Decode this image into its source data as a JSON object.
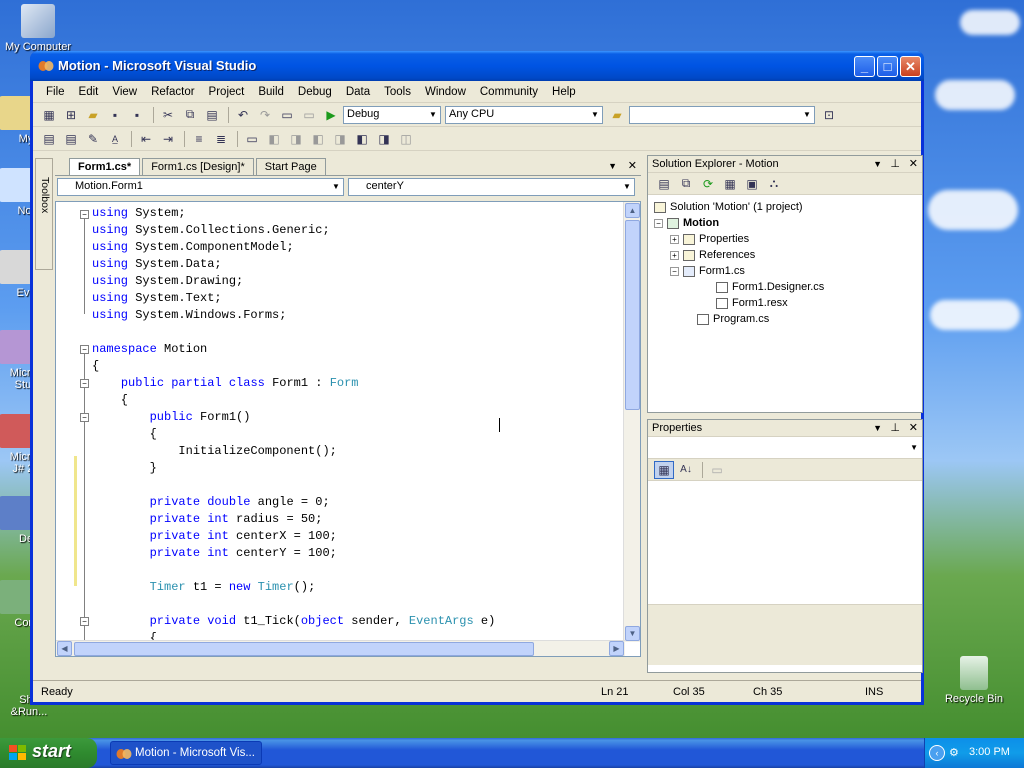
{
  "desktop": {
    "icons": {
      "my_computer": "My Computer",
      "recycle_bin": "Recycle Bin",
      "partial_my": "My",
      "partial_not": "Not",
      "partial_eve": "Eve",
      "partial_micro1": "Micros",
      "partial_stu": "Stud",
      "partial_micro2": "Micros",
      "partial_j": "J# 20",
      "partial_de": "De",
      "partial_cont": "Cont",
      "partial_sho": "Sho",
      "partial_run": "&Run..."
    }
  },
  "window": {
    "title": "Motion - Microsoft Visual Studio",
    "controls": {
      "minimize": "_",
      "maximize": "□",
      "close": "✕"
    }
  },
  "menu": [
    "File",
    "Edit",
    "View",
    "Refactor",
    "Project",
    "Build",
    "Debug",
    "Data",
    "Tools",
    "Window",
    "Community",
    "Help"
  ],
  "toolbar": {
    "config": "Debug",
    "platform": "Any CPU",
    "find_value": ""
  },
  "toolbox_label": "Toolbox",
  "editor": {
    "tabs": [
      "Form1.cs*",
      "Form1.cs [Design]*",
      "Start Page"
    ],
    "tab_controls": {
      "dropdown": "▼",
      "close": "✕"
    },
    "nav_left": "Motion.Form1",
    "nav_right": "centerY",
    "code_lines": [
      "using System;",
      "using System.Collections.Generic;",
      "using System.ComponentModel;",
      "using System.Data;",
      "using System.Drawing;",
      "using System.Text;",
      "using System.Windows.Forms;",
      "",
      "namespace Motion",
      "{",
      "    public partial class Form1 : Form",
      "    {",
      "        public Form1()",
      "        {",
      "            InitializeComponent();",
      "        }",
      "",
      "        private double angle = 0;",
      "        private int radius = 50;",
      "        private int centerX = 100;",
      "        private int centerY = 100;",
      "",
      "        Timer t1 = new Timer();",
      "",
      "        private void t1_Tick(object sender, EventArgs e)",
      "        {"
    ]
  },
  "solution_explorer": {
    "title": "Solution Explorer - Motion",
    "controls": {
      "dropdown": "▼",
      "pin": "⊥",
      "close": "✕"
    },
    "tree": {
      "solution": "Solution 'Motion' (1 project)",
      "project": "Motion",
      "properties": "Properties",
      "references": "References",
      "form1": "Form1.cs",
      "form1_designer": "Form1.Designer.cs",
      "form1_resx": "Form1.resx",
      "program": "Program.cs"
    }
  },
  "properties_pane": {
    "title": "Properties",
    "controls": {
      "dropdown": "▼",
      "pin": "⊥",
      "close": "✕"
    }
  },
  "status": {
    "text": "Ready",
    "ln": "Ln 21",
    "col": "Col 35",
    "ch": "Ch 35",
    "mode": "INS"
  },
  "taskbar": {
    "start": "start",
    "task": "Motion - Microsoft Vis...",
    "clock": "3:00 PM"
  }
}
